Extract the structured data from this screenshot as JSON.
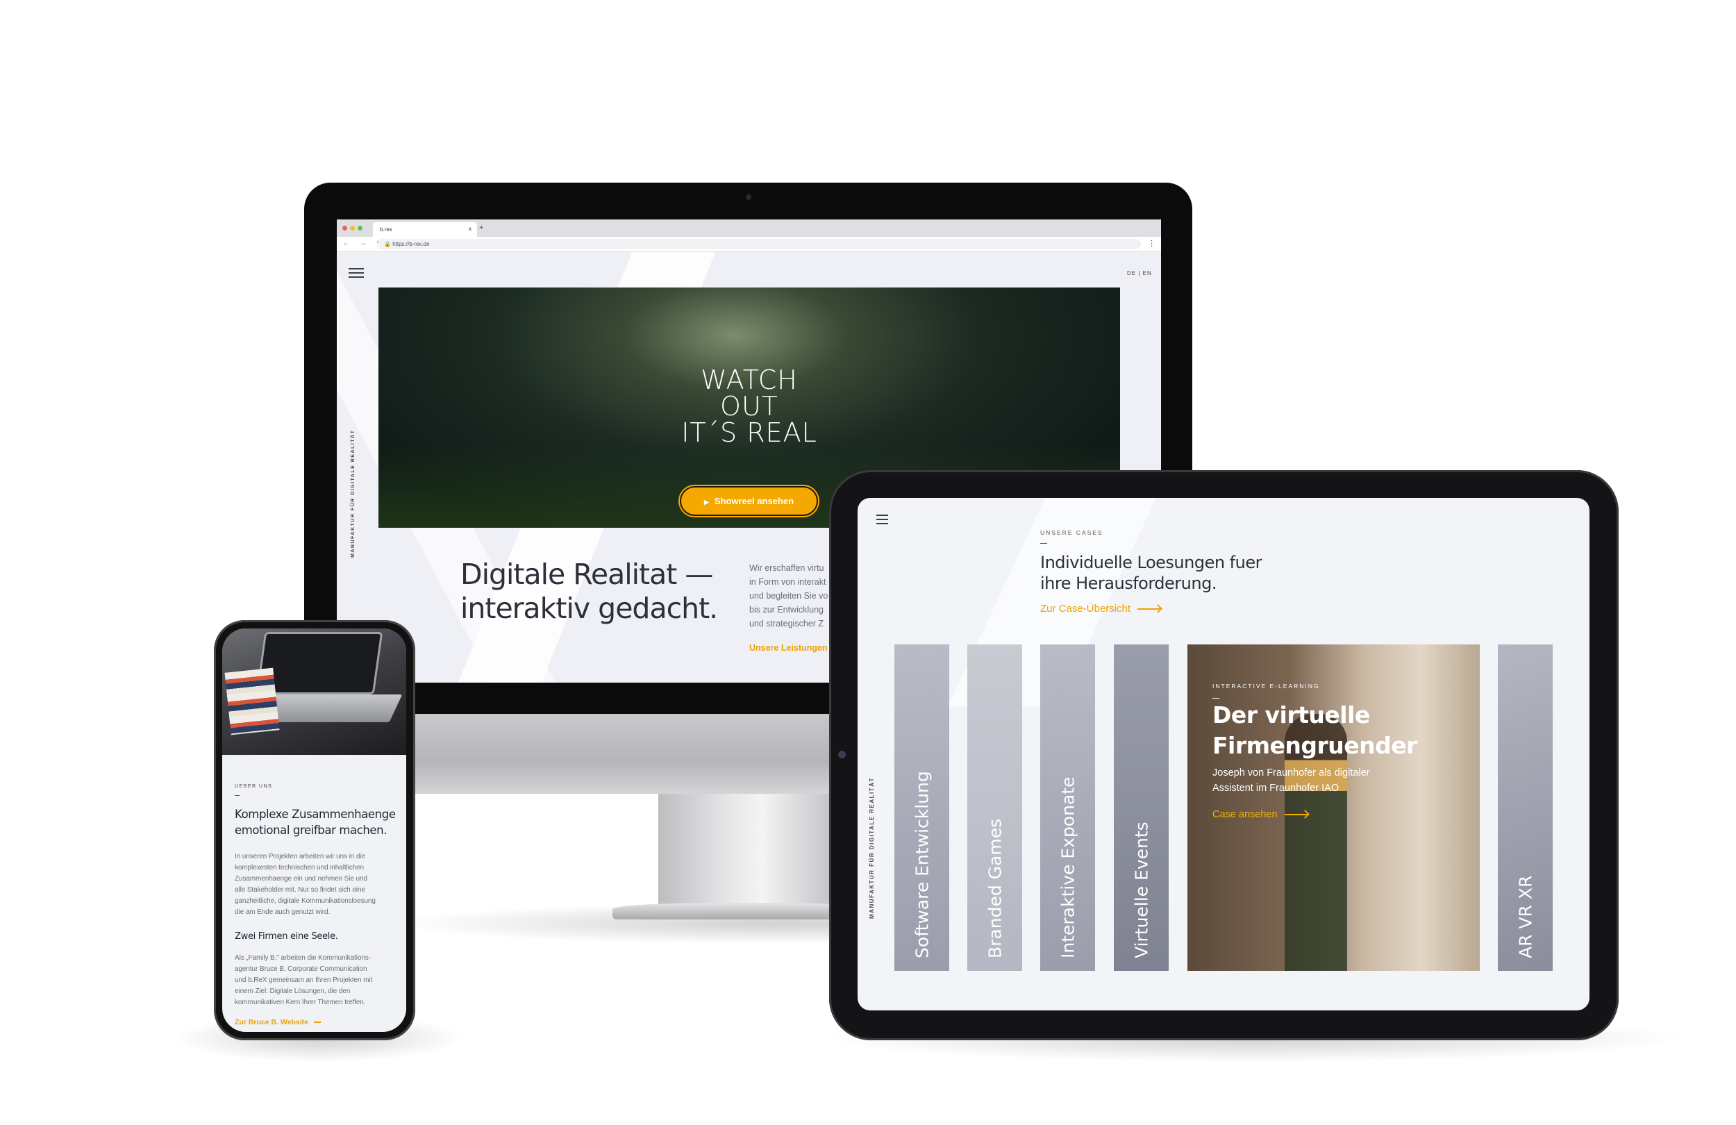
{
  "browser": {
    "tab_title": "b.rex",
    "tab_close": "x",
    "new_tab": "+",
    "nav": "← → C",
    "url": "https://b-rex.de",
    "menu": "⋮"
  },
  "desktop": {
    "lang": "DE | EN",
    "hero_title": [
      "WATCH",
      "OUT",
      "IT´S REAL"
    ],
    "showreel_label": "Showreel ansehen",
    "play_icon": "▶",
    "vertical_tag": "MANUFAKTUR FÜR DIGITALE REALITÄT",
    "headline": [
      "Digitale Realitat —",
      "interaktiv gedacht."
    ],
    "intro_lines": [
      "Wir erschaffen virtu",
      "in Form von interakt",
      "und begleiten Sie vo",
      "bis zur Entwicklung",
      "und strategischer Z"
    ],
    "link": "Unsere Leistungen"
  },
  "tablet": {
    "section_label": "UNSERE CASES",
    "headline": [
      "Individuelle Loesungen fuer",
      "ihre Herausforderung."
    ],
    "link": "Zur Case-Übersicht",
    "vertical_tag": "MANUFAKTUR FÜR DIGITALE REALITÄT",
    "categories": [
      "Software Entwicklung",
      "Branded Games",
      "Interaktive Exponate",
      "Virtuelle Events",
      "AR VR XR"
    ],
    "featured": {
      "label": "INTERACTIVE E-LEARNING",
      "title": [
        "Der virtuelle",
        "Firmengruender"
      ],
      "desc": [
        "Joseph von Fraunhofer als digitaler",
        "Assistent im Fraunhofer IAO"
      ],
      "link": "Case ansehen"
    }
  },
  "phone": {
    "section_label": "UEBER UNS",
    "headline": [
      "Komplexe Zusammenhaenge",
      "emotional greifbar machen."
    ],
    "para1": [
      "In unseren Projekten arbeiten wir uns in die",
      "komplexesten technischen und inhaltlichen",
      "Zusammenhaenge ein und nehmen Sie und",
      "alle Stakeholder mit. Nur so findet sich eine",
      "ganzheitliche, digitale Kommunikationsloesung",
      "die am Ende auch genutzt wird."
    ],
    "subheading": "Zwei Firmen eine Seele.",
    "para2": [
      "Als „Family B.\" arbeiten die Kommunikations-",
      "agentur Bruce B. Corporate Communication",
      "und b.ReX gemeinsam an Ihren Projekten mit",
      "einem Ziel: Digitale Lösungen, die den",
      "kommunikativen Kern Ihrer Themen treffen."
    ],
    "link": "Zur Bruce B. Website"
  },
  "colors": {
    "accent": "#f0a000",
    "text": "#2d2f3a",
    "background": "#eff0f5"
  }
}
